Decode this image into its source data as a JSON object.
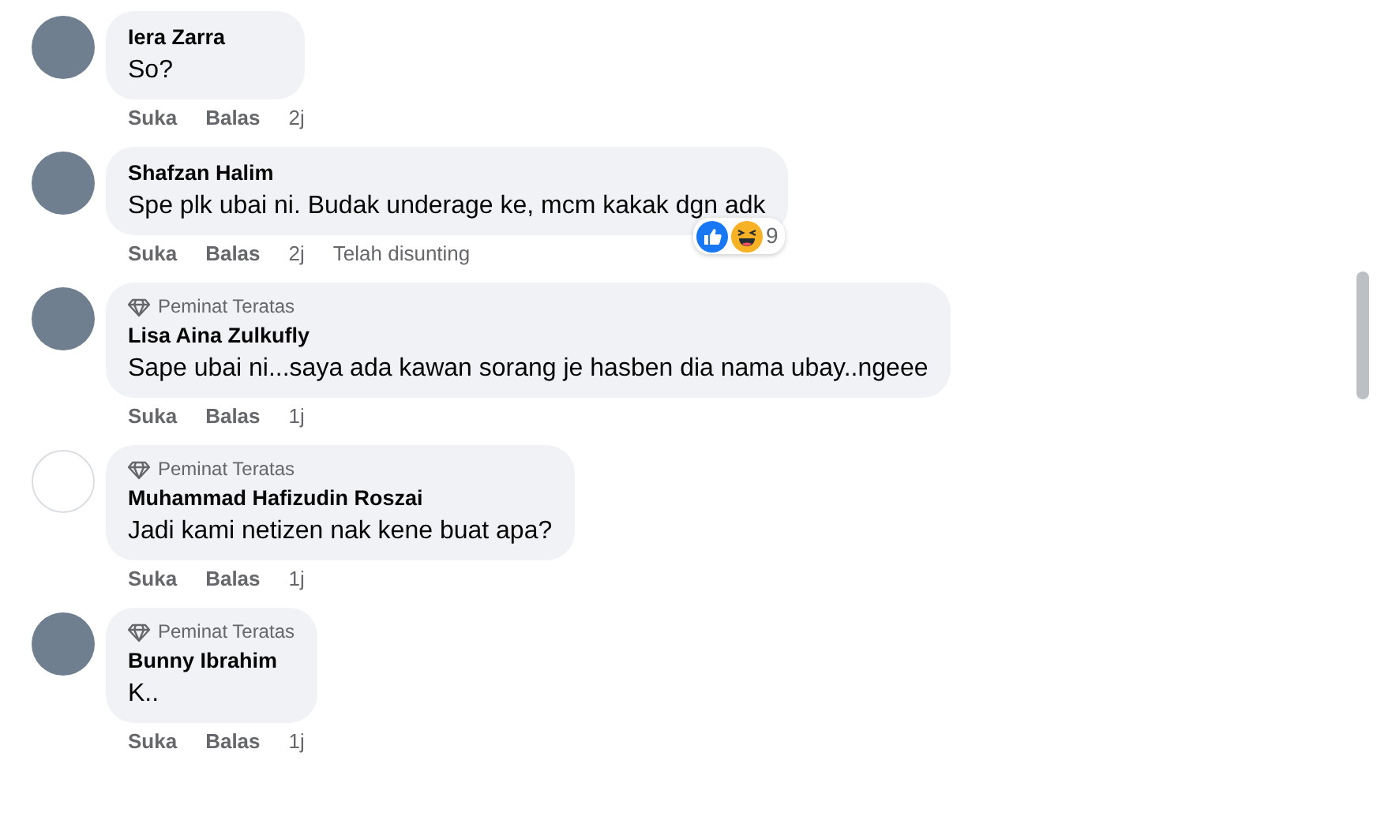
{
  "comments": [
    {
      "blank_avatar": false,
      "name": "Iera Zarra",
      "text": "So?",
      "actions": [
        "Suka",
        "Balas"
      ],
      "time": "2j"
    },
    {
      "blank_avatar": false,
      "name": "Shafzan Halim",
      "text": "Spe plk ubai ni. Budak underage ke, mcm kakak dgn adk",
      "actions": [
        "Suka",
        "Balas"
      ],
      "time": "2j",
      "edited": "Telah disunting",
      "reactions": {
        "types": [
          {
            "kind": "like"
          },
          {
            "kind": "haha"
          }
        ],
        "count": "9"
      }
    },
    {
      "blank_avatar": false,
      "badge": "Peminat Teratas",
      "name": "Lisa Aina Zulkufly",
      "text": "Sape ubai ni...saya ada kawan sorang je hasben dia nama ubay..ngeee",
      "actions": [
        "Suka",
        "Balas"
      ],
      "time": "1j"
    },
    {
      "blank_avatar": true,
      "badge": "Peminat Teratas",
      "name": "Muhammad Hafizudin Roszai",
      "text": "Jadi kami netizen nak kene buat apa?",
      "actions": [
        "Suka",
        "Balas"
      ],
      "time": "1j"
    },
    {
      "blank_avatar": false,
      "badge": "Peminat Teratas",
      "name": "Bunny Ibrahim",
      "text": "K..",
      "actions": [
        "Suka",
        "Balas"
      ],
      "time": "1j"
    }
  ]
}
